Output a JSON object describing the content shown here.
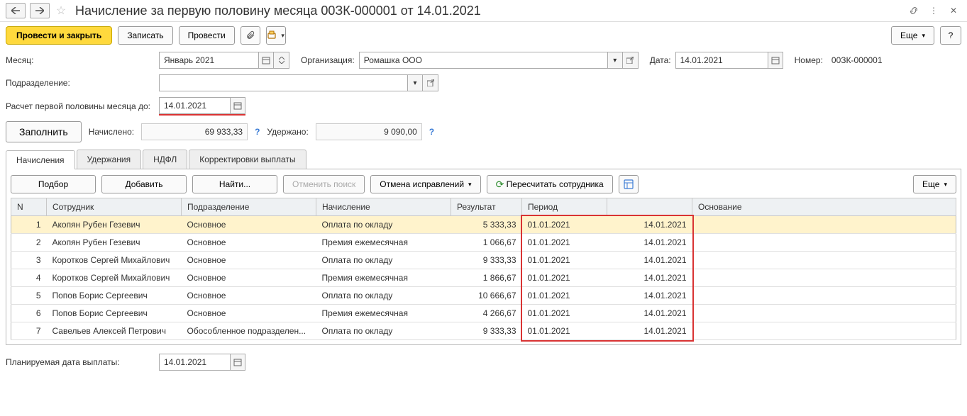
{
  "header": {
    "title": "Начисление за первую половину месяца 00ЗК-000001 от 14.01.2021"
  },
  "toolbar": {
    "post_close": "Провести и закрыть",
    "save": "Записать",
    "post": "Провести",
    "more": "Еще"
  },
  "form": {
    "month_label": "Месяц:",
    "month_value": "Январь 2021",
    "org_label": "Организация:",
    "org_value": "Ромашка ООО",
    "date_label": "Дата:",
    "date_value": "14.01.2021",
    "number_label": "Номер:",
    "number_value": "00ЗК-000001",
    "dept_label": "Подразделение:",
    "dept_value": "",
    "calc_until_label": "Расчет первой половины месяца до:",
    "calc_until_value": "14.01.2021",
    "fill": "Заполнить",
    "accrued_label": "Начислено:",
    "accrued_value": "69 933,33",
    "withheld_label": "Удержано:",
    "withheld_value": "9 090,00",
    "planned_date_label": "Планируемая дата выплаты:",
    "planned_date_value": "14.01.2021"
  },
  "tabs": [
    "Начисления",
    "Удержания",
    "НДФЛ",
    "Корректировки выплаты"
  ],
  "tb2": {
    "pick": "Подбор",
    "add": "Добавить",
    "find": "Найти...",
    "cancel_search": "Отменить поиск",
    "cancel_fix": "Отмена исправлений",
    "recalc": "Пересчитать сотрудника",
    "more": "Еще"
  },
  "grid": {
    "headers": [
      "N",
      "Сотрудник",
      "Подразделение",
      "Начисление",
      "Результат",
      "Период",
      "",
      "Основание"
    ],
    "rows": [
      {
        "n": 1,
        "emp": "Акопян Рубен Гезевич",
        "dept": "Основное",
        "acc": "Оплата по окладу",
        "res": "5 333,33",
        "p1": "01.01.2021",
        "p2": "14.01.2021",
        "base": ""
      },
      {
        "n": 2,
        "emp": "Акопян Рубен Гезевич",
        "dept": "Основное",
        "acc": "Премия ежемесячная",
        "res": "1 066,67",
        "p1": "01.01.2021",
        "p2": "14.01.2021",
        "base": ""
      },
      {
        "n": 3,
        "emp": "Коротков Сергей Михайлович",
        "dept": "Основное",
        "acc": "Оплата по окладу",
        "res": "9 333,33",
        "p1": "01.01.2021",
        "p2": "14.01.2021",
        "base": ""
      },
      {
        "n": 4,
        "emp": "Коротков Сергей Михайлович",
        "dept": "Основное",
        "acc": "Премия ежемесячная",
        "res": "1 866,67",
        "p1": "01.01.2021",
        "p2": "14.01.2021",
        "base": ""
      },
      {
        "n": 5,
        "emp": "Попов Борис Сергеевич",
        "dept": "Основное",
        "acc": "Оплата по окладу",
        "res": "10 666,67",
        "p1": "01.01.2021",
        "p2": "14.01.2021",
        "base": ""
      },
      {
        "n": 6,
        "emp": "Попов Борис Сергеевич",
        "dept": "Основное",
        "acc": "Премия ежемесячная",
        "res": "4 266,67",
        "p1": "01.01.2021",
        "p2": "14.01.2021",
        "base": ""
      },
      {
        "n": 7,
        "emp": "Савельев Алексей Петрович",
        "dept": "Обособленное подразделен...",
        "acc": "Оплата по окладу",
        "res": "9 333,33",
        "p1": "01.01.2021",
        "p2": "14.01.2021",
        "base": ""
      }
    ]
  }
}
